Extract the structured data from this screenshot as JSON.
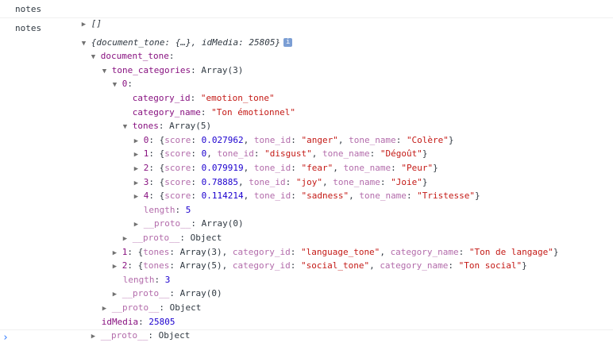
{
  "console": {
    "entry1": {
      "source": "notes",
      "summary": "[]"
    },
    "entry2": {
      "source": "notes",
      "summary": "{document_tone: {…}, idMedia: 25805}",
      "info_badge": "i",
      "document_tone_key": "document_tone",
      "tone_categories_key": "tone_categories",
      "tone_categories_type": "Array(3)",
      "cat0_index": "0",
      "cat0_category_id_key": "category_id",
      "cat0_category_id_value": "\"emotion_tone\"",
      "cat0_category_name_key": "category_name",
      "cat0_category_name_value": "\"Ton émotionnel\"",
      "tones_key": "tones",
      "tones_type": "Array(5)",
      "tones": [
        {
          "idx": "0",
          "score": "0.027962",
          "tone_id": "\"anger\"",
          "tone_name": "\"Colère\""
        },
        {
          "idx": "1",
          "score": "0",
          "tone_id": "\"disgust\"",
          "tone_name": "\"Dégoût\""
        },
        {
          "idx": "2",
          "score": "0.079919",
          "tone_id": "\"fear\"",
          "tone_name": "\"Peur\""
        },
        {
          "idx": "3",
          "score": "0.78885",
          "tone_id": "\"joy\"",
          "tone_name": "\"Joie\""
        },
        {
          "idx": "4",
          "score": "0.114214",
          "tone_id": "\"sadness\"",
          "tone_name": "\"Tristesse\""
        }
      ],
      "tones_length_key": "length",
      "tones_length_value": "5",
      "tones_proto_key": "__proto__",
      "tones_proto_value": "Array(0)",
      "cat0_proto_key": "__proto__",
      "cat0_proto_value": "Object",
      "cat1_index": "1",
      "cat1_tones": "Array(3)",
      "cat1_category_id": "\"language_tone\"",
      "cat1_category_name": "\"Ton de langage\"",
      "cat2_index": "2",
      "cat2_tones": "Array(5)",
      "cat2_category_id": "\"social_tone\"",
      "cat2_category_name": "\"Ton social\"",
      "categories_length_key": "length",
      "categories_length_value": "3",
      "categories_proto_key": "__proto__",
      "categories_proto_value": "Array(0)",
      "document_tone_proto_key": "__proto__",
      "document_tone_proto_value": "Object",
      "idMedia_key": "idMedia",
      "idMedia_value": "25805",
      "root_proto_key": "__proto__",
      "root_proto_value": "Object"
    }
  },
  "prompt": {
    "caret": "›"
  }
}
